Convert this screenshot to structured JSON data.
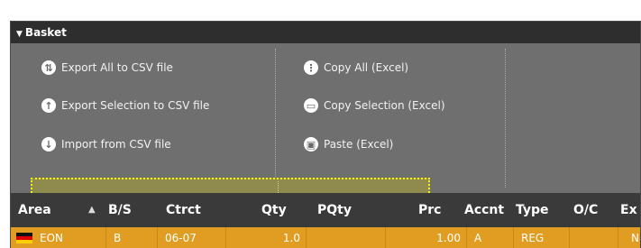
{
  "panel": {
    "title": "Basket"
  },
  "menu": {
    "export_all": {
      "label": "Export All to CSV file",
      "icon": "double-arrow-icon"
    },
    "export_selection": {
      "label": "Export Selection to CSV file",
      "icon": "up-arrow-icon"
    },
    "import_csv": {
      "label": "Import from CSV file",
      "icon": "down-arrow-icon"
    },
    "copy_all": {
      "label": "Copy All (Excel)",
      "icon": "copy-all-icon"
    },
    "copy_selection": {
      "label": "Copy Selection (Excel)",
      "icon": "copy-icon"
    },
    "paste": {
      "label": "Paste (Excel)",
      "icon": "paste-icon"
    }
  },
  "grid": {
    "columns": [
      "Area",
      "B/S",
      "Ctrct",
      "Qty",
      "PQty",
      "Prc",
      "Accnt",
      "Type",
      "O/C",
      "Ex"
    ],
    "sort_column": "Area",
    "rows": [
      {
        "area": "EON",
        "bs": "B",
        "ctrct": "06-07",
        "qty": "1.0",
        "pqty": "",
        "prc": "1.00",
        "accnt": "A",
        "type": "REG",
        "oc": "",
        "ex": "N"
      }
    ]
  },
  "colors": {
    "row_selected": "#e09d22",
    "highlight_border": "#f4f400",
    "header_bg": "#2e2e2e"
  }
}
